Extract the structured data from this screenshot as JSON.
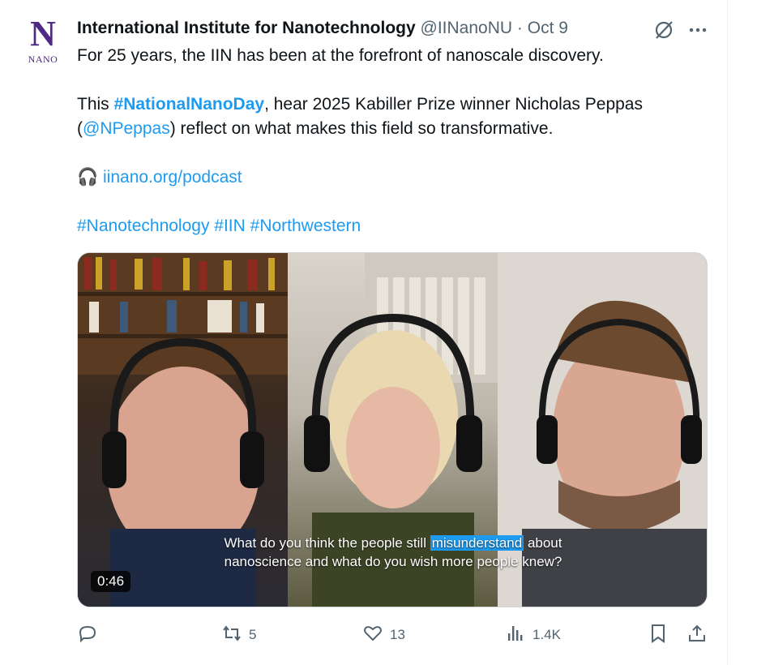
{
  "account": {
    "avatar_letter": "N",
    "avatar_sub": "NANO",
    "avatar_color": "#4e2a84",
    "name": "International Institute for Nanotechnology",
    "handle": "@IINanoNU",
    "separator": "·",
    "date": "Oct 9"
  },
  "header_icons": [
    "grok-icon",
    "more-icon"
  ],
  "tweet": {
    "line1": "For 25 years, the IIN has been at the forefront of nanoscale discovery.",
    "line2_pre": "This ",
    "line2_hashtag": "#NationalNanoDay",
    "line2_post": ", hear 2025 Kabiller Prize winner Nicholas Peppas",
    "line3_open": "(",
    "line3_mention": "@NPeppas",
    "line3_post": ") reflect on what makes this field so transformative.",
    "podcast_icon": "🎧",
    "podcast_link": "iinano.org/podcast",
    "hashtags": "#Nanotechnology #IIN #Northwestern"
  },
  "media": {
    "caption_pre": "What do you think the people still ",
    "caption_highlight": "misunderstand",
    "caption_post": " about",
    "caption_line2": "nanoscience and what do you wish more people knew?",
    "duration": "0:46"
  },
  "actions": {
    "reply_count": "",
    "retweet_count": "5",
    "like_count": "13",
    "views_count": "1.4K"
  },
  "colors": {
    "link": "#1d9bf0",
    "muted": "#536471",
    "text": "#0f1419"
  }
}
